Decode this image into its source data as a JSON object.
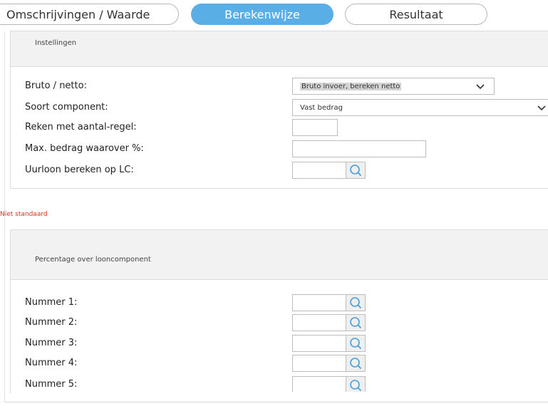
{
  "tabs": [
    {
      "label": "Omschrijvingen / Waarde",
      "active": false
    },
    {
      "label": "Berekenwijze",
      "active": true
    },
    {
      "label": "Resultaat",
      "active": false
    }
  ],
  "settings": {
    "heading": "Instellingen",
    "bruto_netto_label": "Bruto / netto:",
    "bruto_netto_value": "Bruto invoer, bereken netto",
    "soort_label": "Soort component:",
    "soort_value": "Vast bedrag",
    "aantal_regel_label": "Reken met aantal-regel:",
    "max_bedrag_label": "Max. bedrag waarover %:",
    "uurloon_label": "Uurloon bereken op LC:"
  },
  "warning": "Niet standaard",
  "percentage": {
    "heading": "Percentage over looncomponent",
    "rows": [
      "Nummer 1:",
      "Nummer 2:",
      "Nummer 3:",
      "Nummer 4:",
      "Nummer 5:"
    ]
  },
  "colors": {
    "accent": "#5aaee6",
    "warning": "#e0301e",
    "icon": "#4a9fd8"
  }
}
